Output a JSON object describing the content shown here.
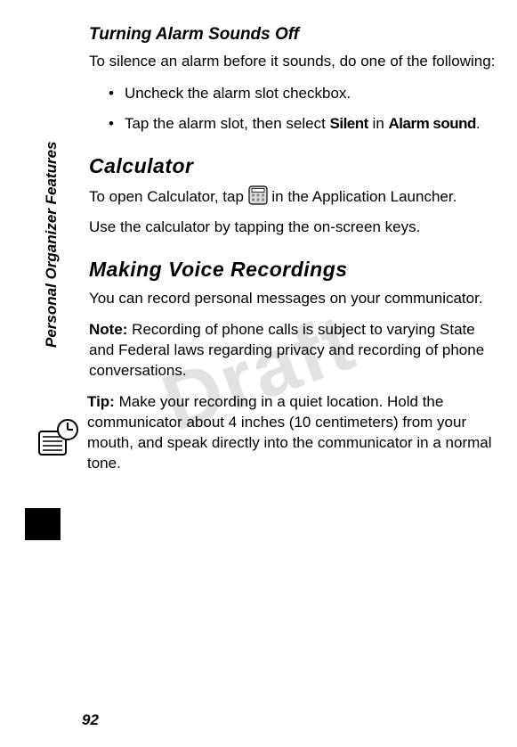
{
  "watermark": "Draft",
  "sidebar_label": "Personal Organizer Features",
  "page_number": "92",
  "section_alarm": {
    "heading": "Turning Alarm Sounds Off",
    "intro": "To silence an alarm before it sounds, do one of the following:",
    "items": [
      "Uncheck the alarm slot checkbox.",
      {
        "pre": "Tap the alarm slot, then select ",
        "bold1": "Silent",
        "mid": " in ",
        "bold2": "Alarm sound",
        "post": "."
      }
    ]
  },
  "section_calc": {
    "heading": "Calculator",
    "line1_pre": "To open Calculator, tap ",
    "line1_post": " in the Application Launcher.",
    "line2": "Use the calculator by tapping the on-screen keys."
  },
  "section_voice": {
    "heading": "Making Voice Recordings",
    "p1": "You can record personal messages on your communicator.",
    "note_label": "Note:",
    "note_body": " Recording of phone calls is subject to varying State and Federal laws regarding privacy and recording of phone conversations.",
    "tip_label": "Tip:",
    "tip_body": " Make your recording in a quiet location. Hold the communicator about 4 inches (10 centimeters) from your mouth, and speak directly into the communicator in a normal tone."
  }
}
